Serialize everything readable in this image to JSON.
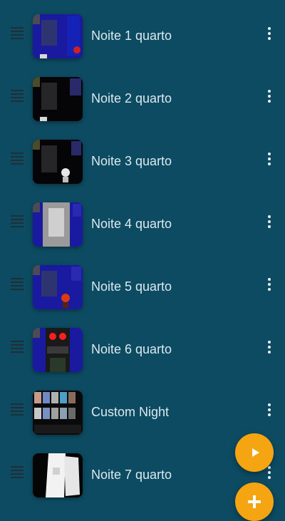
{
  "list": {
    "items": [
      {
        "label": "Noite 1 quarto",
        "thumb": "night-1-thumbnail"
      },
      {
        "label": "Noite 2 quarto",
        "thumb": "night-2-thumbnail"
      },
      {
        "label": "Noite 3 quarto",
        "thumb": "night-3-thumbnail"
      },
      {
        "label": "Noite 4 quarto",
        "thumb": "night-4-thumbnail"
      },
      {
        "label": "Noite 5 quarto",
        "thumb": "night-5-thumbnail"
      },
      {
        "label": "Noite 6 quarto",
        "thumb": "night-6-thumbnail"
      },
      {
        "label": "Custom Night",
        "thumb": "custom-night-thumbnail"
      },
      {
        "label": "Noite 7 quarto",
        "thumb": "night-7-thumbnail"
      }
    ]
  },
  "colors": {
    "background": "#0d4b62",
    "accent": "#f5a511",
    "text": "#dbe9ee"
  },
  "icons": {
    "drag": "drag-handle-icon",
    "more": "more-vert-icon",
    "play": "play-icon",
    "add": "add-icon"
  }
}
